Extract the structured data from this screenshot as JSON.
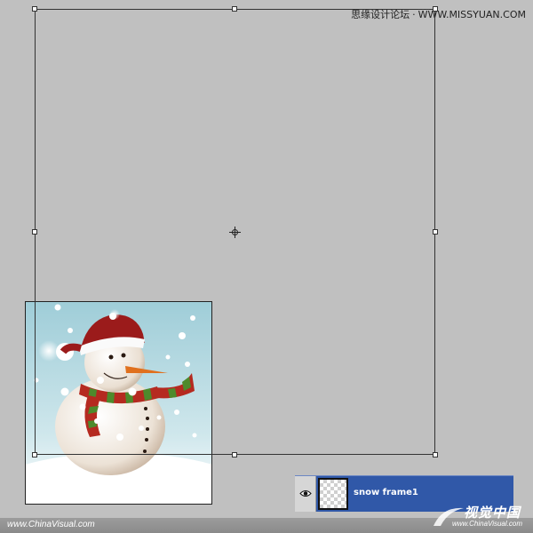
{
  "watermark_top": {
    "site_cn": "思缘设计论坛",
    "site_url": "WWW.MISSYUAN.COM"
  },
  "layer": {
    "name": "snow frame1",
    "visibility_icon": "eye-icon",
    "thumbnail": "transparent-checker"
  },
  "footer": {
    "left_text": "www.ChinaVisual.com",
    "logo_main": "视觉中国",
    "logo_sub": "www.ChinaVisual.com"
  },
  "preview": {
    "subject": "snowman",
    "sky_color": "#a8d4df",
    "hat_color": "#9b1b1b",
    "scarf_colors": [
      "#b52a20",
      "#4e8a2c"
    ]
  },
  "colors": {
    "canvas": "#c0c0c0",
    "layer_selected": "#3058a8",
    "bottom_bar": "#8e8e8e"
  }
}
